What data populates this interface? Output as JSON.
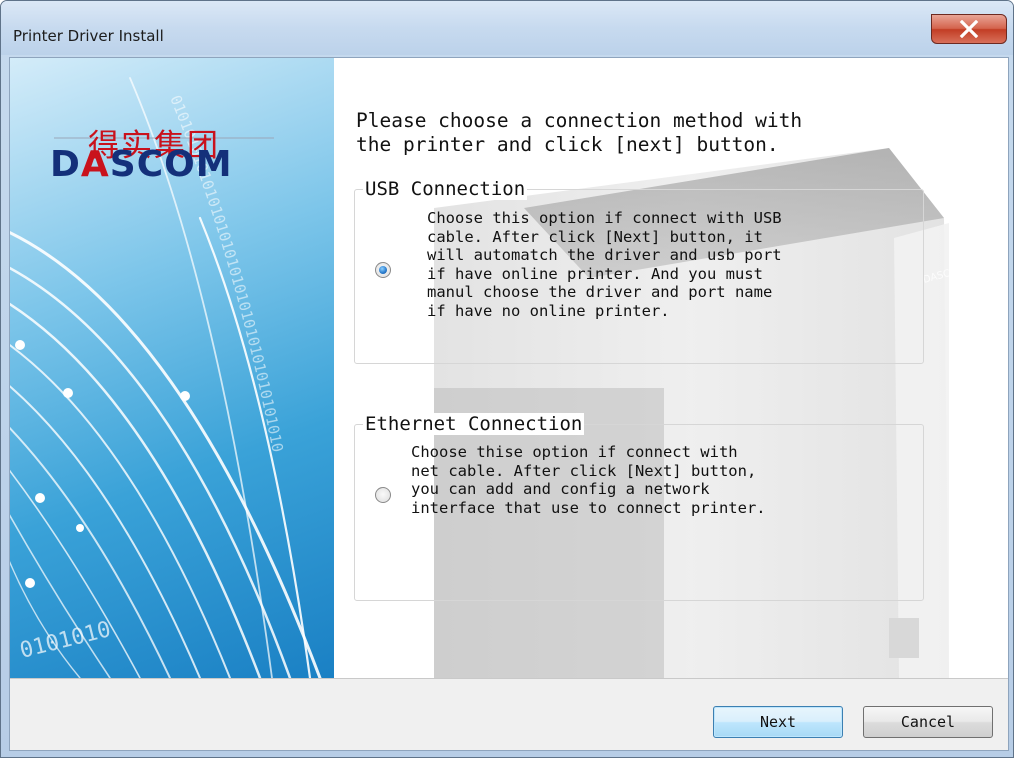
{
  "window": {
    "title": "Printer Driver Install",
    "close_icon": "close-icon",
    "close_color": "#c7432b"
  },
  "banner": {
    "brand_cn": "得实集团",
    "brand_en_before": "D",
    "brand_en_accent": "A",
    "brand_en_after": "SCOM",
    "binary_bottom": "0101010",
    "binary_arc": "01010101010101010101010101010101010101010",
    "accent_color": "#c9121c",
    "brand_color": "#14307a"
  },
  "main": {
    "instruction": "Please choose a connection method with\nthe printer and click [next] button.",
    "printer_logo_text": "DASCOM",
    "options": [
      {
        "legend": "USB Connection",
        "description": "Choose this option if connect with USB\ncable. After click [Next] button, it\nwill automatch the driver and usb port\nif have online printer. And you must\nmanul choose the driver and port name\nif have no online printer.",
        "selected": true
      },
      {
        "legend": "Ethernet Connection",
        "description": "Choose thise option if connect with\nnet cable. After click [Next] button,\nyou can add and config a network\ninterface that use to connect printer.",
        "selected": false
      }
    ]
  },
  "footer": {
    "next_label": "Next",
    "cancel_label": "Cancel"
  }
}
